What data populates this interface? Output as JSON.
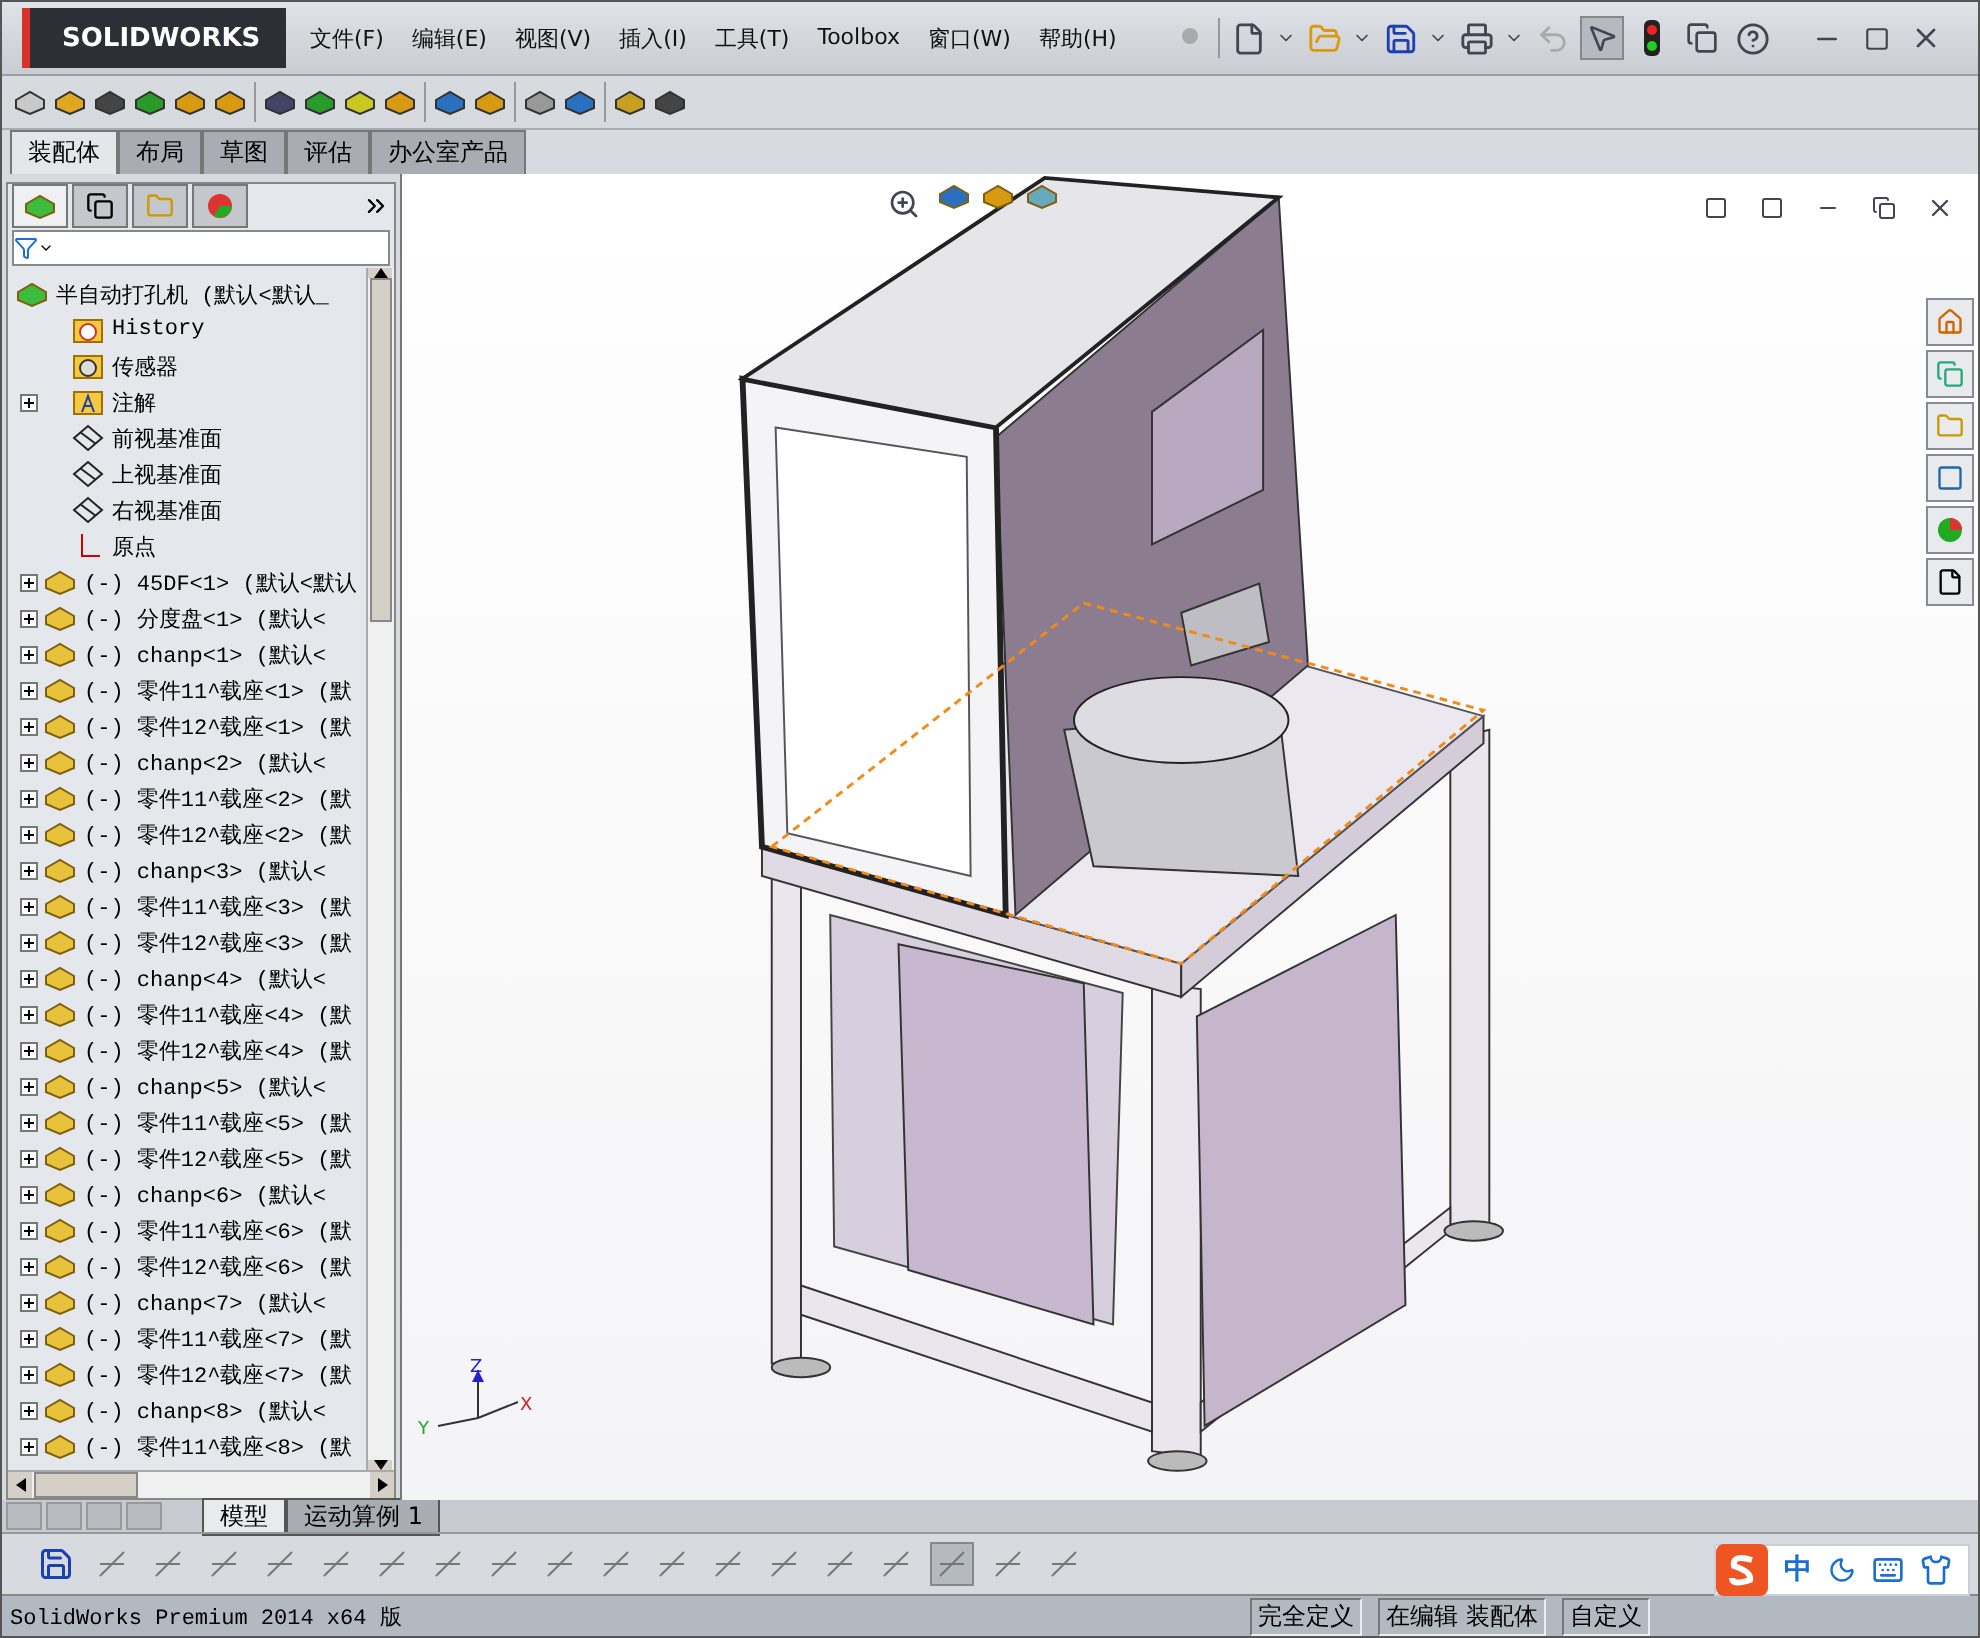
{
  "app": {
    "logo": "SOLIDWORKS"
  },
  "menu": [
    {
      "label": "文件(F)"
    },
    {
      "label": "编辑(E)"
    },
    {
      "label": "视图(V)"
    },
    {
      "label": "插入(I)"
    },
    {
      "label": "工具(T)"
    },
    {
      "label": "Toolbox"
    },
    {
      "label": "窗口(W)"
    },
    {
      "label": "帮助(H)"
    }
  ],
  "command_tabs": [
    {
      "label": "装配体",
      "selected": true
    },
    {
      "label": "布局",
      "selected": false
    },
    {
      "label": "草图",
      "selected": false
    },
    {
      "label": "评估",
      "selected": false
    },
    {
      "label": "办公室产品",
      "selected": false
    }
  ],
  "tree": {
    "root": "半自动打孔机 (默认<默认_",
    "items": [
      {
        "kind": "history",
        "label": "History"
      },
      {
        "kind": "sensor",
        "label": "传感器"
      },
      {
        "kind": "annotation",
        "label": "注解",
        "expanded": false
      },
      {
        "kind": "plane",
        "label": "前视基准面"
      },
      {
        "kind": "plane",
        "label": "上视基准面"
      },
      {
        "kind": "plane",
        "label": "右视基准面"
      },
      {
        "kind": "origin",
        "label": "原点"
      },
      {
        "kind": "part",
        "label": "(-) 45DF<1> (默认<默认",
        "expanded": false
      },
      {
        "kind": "part",
        "label": "(-) 分度盘<1> (默认<",
        "expanded": false
      },
      {
        "kind": "part",
        "label": "(-) chanp<1> (默认<",
        "expanded": false
      },
      {
        "kind": "part",
        "label": "(-) 零件11^载座<1> (默",
        "expanded": false
      },
      {
        "kind": "part",
        "label": "(-) 零件12^载座<1> (默",
        "expanded": false
      },
      {
        "kind": "part",
        "label": "(-) chanp<2> (默认<",
        "expanded": false
      },
      {
        "kind": "part",
        "label": "(-) 零件11^载座<2> (默",
        "expanded": false
      },
      {
        "kind": "part",
        "label": "(-) 零件12^载座<2> (默",
        "expanded": false
      },
      {
        "kind": "part",
        "label": "(-) chanp<3> (默认<",
        "expanded": false
      },
      {
        "kind": "part",
        "label": "(-) 零件11^载座<3> (默",
        "expanded": false
      },
      {
        "kind": "part",
        "label": "(-) 零件12^载座<3> (默",
        "expanded": false
      },
      {
        "kind": "part",
        "label": "(-) chanp<4> (默认<",
        "expanded": false
      },
      {
        "kind": "part",
        "label": "(-) 零件11^载座<4> (默",
        "expanded": false
      },
      {
        "kind": "part",
        "label": "(-) 零件12^载座<4> (默",
        "expanded": false
      },
      {
        "kind": "part",
        "label": "(-) chanp<5> (默认<",
        "expanded": false
      },
      {
        "kind": "part",
        "label": "(-) 零件11^载座<5> (默",
        "expanded": false
      },
      {
        "kind": "part",
        "label": "(-) 零件12^载座<5> (默",
        "expanded": false
      },
      {
        "kind": "part",
        "label": "(-) chanp<6> (默认<",
        "expanded": false
      },
      {
        "kind": "part",
        "label": "(-) 零件11^载座<6> (默",
        "expanded": false
      },
      {
        "kind": "part",
        "label": "(-) 零件12^载座<6> (默",
        "expanded": false
      },
      {
        "kind": "part",
        "label": "(-) chanp<7> (默认<",
        "expanded": false
      },
      {
        "kind": "part",
        "label": "(-) 零件11^载座<7> (默",
        "expanded": false
      },
      {
        "kind": "part",
        "label": "(-) 零件12^载座<7> (默",
        "expanded": false
      },
      {
        "kind": "part",
        "label": "(-) chanp<8> (默认<",
        "expanded": false
      },
      {
        "kind": "part",
        "label": "(-) 零件11^载座<8> (默",
        "expanded": false
      }
    ]
  },
  "bottom_tabs": [
    {
      "label": "模型",
      "selected": true
    },
    {
      "label": "运动算例 1",
      "selected": false
    }
  ],
  "status": {
    "product": "SolidWorks Premium 2014 x64 版",
    "fields": [
      "完全定义",
      "在编辑 装配体",
      "自定义"
    ]
  },
  "ime": {
    "mode": "中"
  },
  "triad": {
    "x": "X",
    "y": "Y",
    "z": "Z"
  }
}
